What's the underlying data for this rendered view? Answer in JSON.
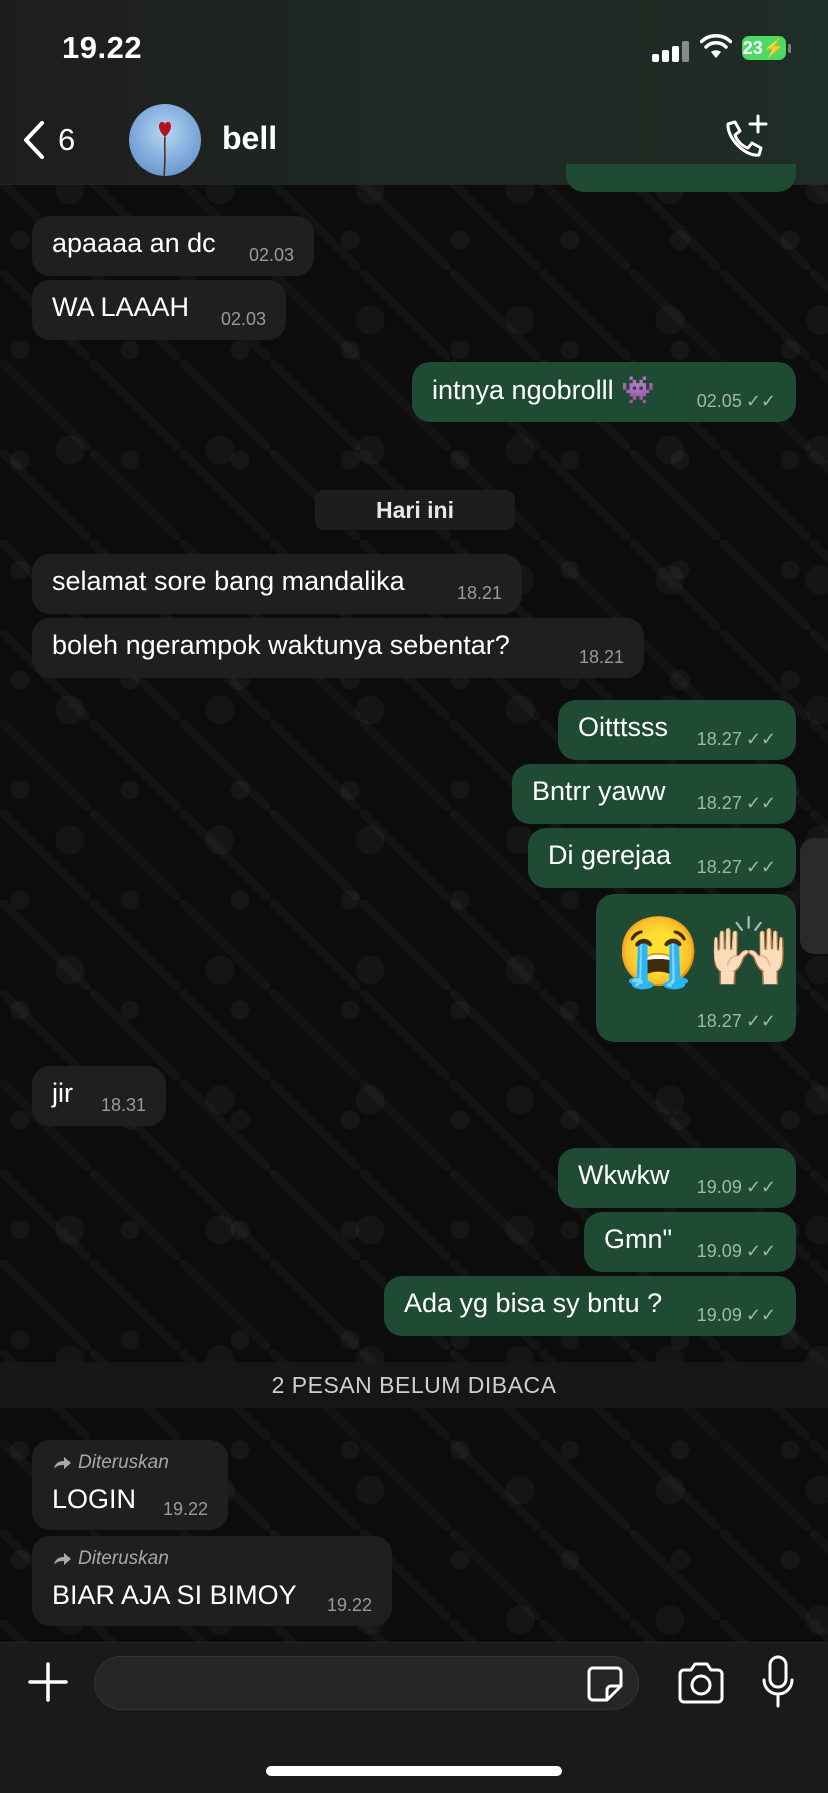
{
  "status": {
    "time": "19.22",
    "battery": "23"
  },
  "header": {
    "back_count": "6",
    "contact_name": "bell"
  },
  "date_divider": "Hari ini",
  "messages": [
    {
      "dir": "in",
      "text": "apaaaa an dc",
      "time": "02.03"
    },
    {
      "dir": "in",
      "text": "WA LAAAH",
      "time": "02.03"
    },
    {
      "dir": "out",
      "text": "intnya ngobrolll 👾",
      "time": "02.05"
    },
    {
      "dir": "in",
      "text": "selamat sore bang mandalika",
      "time": "18.21"
    },
    {
      "dir": "in",
      "text": "boleh ngerampok waktunya sebentar?",
      "time": "18.21"
    },
    {
      "dir": "out",
      "text": "Oitttsss",
      "time": "18.27"
    },
    {
      "dir": "out",
      "text": "Bntrr yaww",
      "time": "18.27"
    },
    {
      "dir": "out",
      "text": "Di gerejaa",
      "time": "18.27"
    },
    {
      "dir": "out",
      "text": "😭🙌🏻",
      "time": "18.27"
    },
    {
      "dir": "in",
      "text": "jir",
      "time": "18.31"
    },
    {
      "dir": "out",
      "text": "Wkwkw",
      "time": "19.09"
    },
    {
      "dir": "out",
      "text": "Gmn\"",
      "time": "19.09"
    },
    {
      "dir": "out",
      "text": "Ada yg bisa sy bntu ?",
      "time": "19.09"
    },
    {
      "dir": "in",
      "forwarded": "Diteruskan",
      "text": "LOGIN",
      "time": "19.22"
    },
    {
      "dir": "in",
      "forwarded": "Diteruskan",
      "text": "BIAR AJA SI BIMOY",
      "time": "19.22"
    }
  ],
  "unread_banner": "2 PESAN BELUM DIBACA",
  "composer": {
    "placeholder": ""
  },
  "colors": {
    "incoming_bubble": "#1f1f1f",
    "outgoing_bubble": "#1f4a33",
    "battery": "#4cd964"
  },
  "icons": [
    "back-chevron-icon",
    "add-call-icon",
    "plus-icon",
    "sticker-icon",
    "camera-icon",
    "microphone-icon",
    "double-check-icon",
    "forward-arrow-icon"
  ]
}
